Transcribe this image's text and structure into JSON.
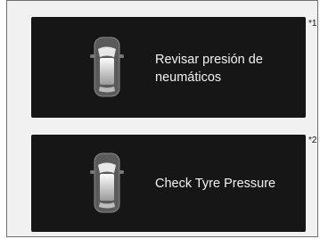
{
  "displays": [
    {
      "line1": "Revisar presión de",
      "line2": "neumáticos",
      "footnote": "*1",
      "icon": "car-top-view-icon"
    },
    {
      "line1": "Check Tyre Pressure",
      "line2": "",
      "footnote": "*2",
      "icon": "car-top-view-icon"
    }
  ],
  "colors": {
    "screen_bg": "#161616",
    "text": "#f3f3f3",
    "frame_bg": "#f1f1f1",
    "frame_border": "#6f6f6f"
  }
}
